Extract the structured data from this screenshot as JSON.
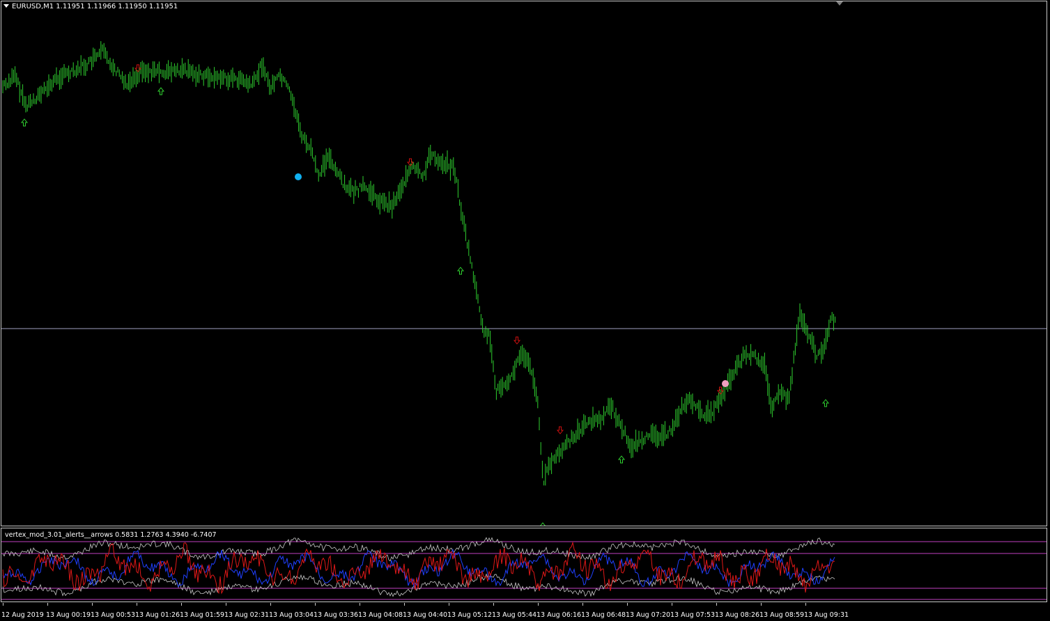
{
  "main_chart": {
    "title": "EURUSD,M1  1.11951 1.11966 1.11950 1.11951",
    "colors": {
      "bars": "#2fd02f",
      "up_arrow": "#2fd02f",
      "down_arrow": "#d01010",
      "blue_dot": "#10b0f0",
      "pink_dot": "#f0a0c0",
      "hline": "#a0a0c0"
    }
  },
  "indicator": {
    "title": "vertex_mod_3.01_alerts__arrows 0.5831 1.2763 4.3940 -6.7407",
    "colors": {
      "level": "#c040c0",
      "band": "#c8c8c8",
      "red": "#e01818",
      "blue": "#2040ff"
    }
  },
  "time_axis": {
    "labels": [
      "12 Aug 2019",
      "13 Aug 00:19",
      "13 Aug 00:53",
      "13 Aug 01:26",
      "13 Aug 01:59",
      "13 Aug 02:31",
      "13 Aug 03:04",
      "13 Aug 03:36",
      "13 Aug 04:08",
      "13 Aug 04:40",
      "13 Aug 05:12",
      "13 Aug 05:44",
      "13 Aug 06:16",
      "13 Aug 06:48",
      "13 Aug 07:20",
      "13 Aug 07:53",
      "13 Aug 08:26",
      "13 Aug 08:59",
      "13 Aug 09:31"
    ]
  }
}
